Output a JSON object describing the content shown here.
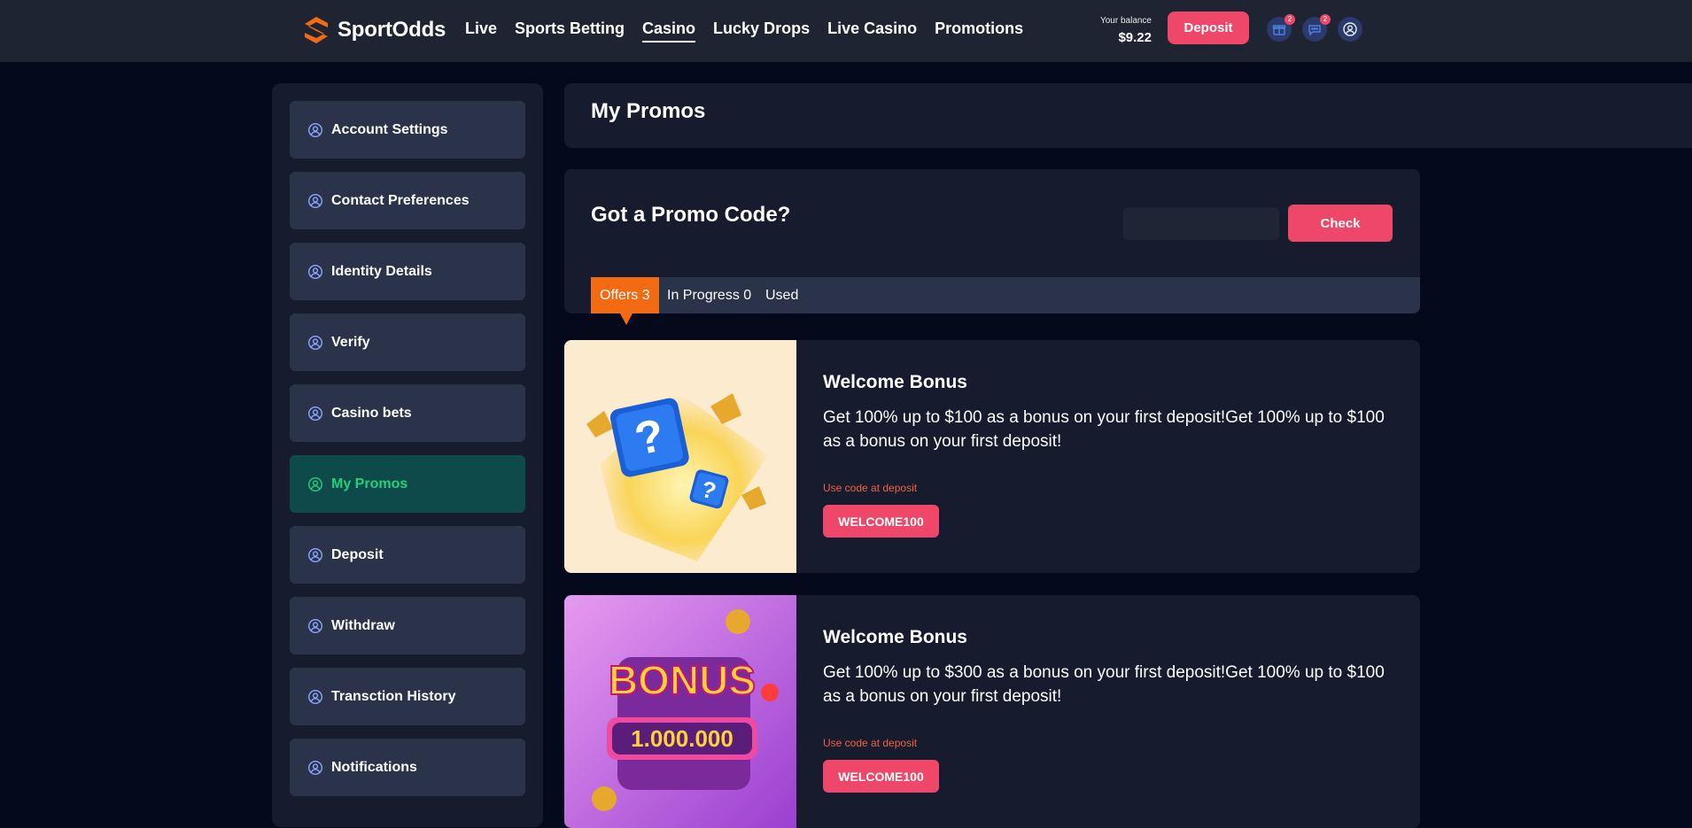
{
  "brand": {
    "name": "SportOdds"
  },
  "nav": {
    "items": [
      {
        "label": "Live"
      },
      {
        "label": "Sports Betting"
      },
      {
        "label": "Casino",
        "active": true
      },
      {
        "label": "Lucky Drops"
      },
      {
        "label": "Live Casino"
      },
      {
        "label": "Promotions"
      }
    ]
  },
  "header": {
    "balance_label": "Your balance",
    "balance_value": "$9.22",
    "deposit_label": "Deposit",
    "gift_badge": "2",
    "chat_badge": "2",
    "icons": [
      "gift-icon",
      "chat-icon",
      "user-icon"
    ]
  },
  "sidebar": {
    "items": [
      {
        "label": "Account Settings"
      },
      {
        "label": "Contact Preferences"
      },
      {
        "label": "Identity Details"
      },
      {
        "label": "Verify"
      },
      {
        "label": "Casino bets"
      },
      {
        "label": "My Promos",
        "active": true
      },
      {
        "label": "Deposit"
      },
      {
        "label": "Withdraw"
      },
      {
        "label": "Transction History"
      },
      {
        "label": "Notifications"
      }
    ]
  },
  "main": {
    "title": "My Promos",
    "promo": {
      "title": "Got a Promo Code?",
      "input_value": "",
      "check_label": "Check"
    },
    "tabs": [
      {
        "label": "Offers 3",
        "active": true
      },
      {
        "label": "In Progress 0"
      },
      {
        "label": "Used"
      }
    ],
    "offers": [
      {
        "title": "Welcome Bonus",
        "description": "Get 100% up to $100 as a bonus on your first deposit!Get 100% up to $100 as a bonus on your first deposit!",
        "hint": "Use code at deposit",
        "code": "WELCOME100"
      },
      {
        "title": "Welcome Bonus",
        "description": "Get 100% up to $300 as a bonus on your first deposit!Get 100% up to $100 as a bonus on your first deposit!",
        "hint": "Use code at deposit",
        "code": "WELCOME100",
        "image_text": "BONUS",
        "image_amount": "1.000.000"
      }
    ]
  },
  "colors": {
    "accent": "#ef476a",
    "tab_active": "#f26a12",
    "sidebar_active_text": "#21d07a",
    "hint": "#f5603a"
  }
}
